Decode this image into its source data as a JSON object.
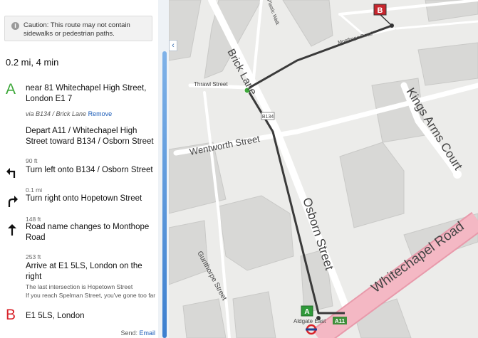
{
  "directions": {
    "caution": "Caution: This route may not contain sidewalks or pedestrian paths.",
    "caution_icon": "info-icon",
    "summary": "0.2 mi, 4 min",
    "start": {
      "letter": "A",
      "address": "near 81 Whitechapel High Street, London E1 7"
    },
    "via": {
      "text": "via B134 / Brick Lane",
      "remove": "Remove"
    },
    "steps": [
      {
        "instruction": "Depart A11 / Whitechapel High Street toward B134 / Osborn Street"
      },
      {
        "distance": "90 ft",
        "instruction": "Turn left onto B134 / Osborn Street",
        "icon": "turn-left-icon"
      },
      {
        "distance": "0.1 mi",
        "instruction": "Turn right onto Hopetown Street",
        "icon": "turn-right-icon"
      },
      {
        "distance": "148 ft",
        "instruction": "Road name changes to Monthope Road",
        "icon": "straight-arrow-icon"
      },
      {
        "distance": "253 ft",
        "instruction": "Arrive at E1 5LS, London on the right",
        "notes": [
          "The last intersection is Hopetown Street",
          "If you reach Spelman Street, you've gone too far"
        ]
      }
    ],
    "end": {
      "letter": "B",
      "address": "E1 5LS, London"
    },
    "send": {
      "label": "Send:",
      "link": "Email"
    }
  },
  "map": {
    "streets": {
      "brick_lane": "Brick Lane",
      "osborn": "Osborn Street",
      "whitechapel": "Whitechapel Road",
      "wentworth": "Wentworth Street",
      "kings_arms": "Kings Arms Court",
      "thrawl": "Thrawl Street",
      "monthope": "Monthope Road",
      "gunthorpe": "Gunthorpe Street",
      "plastic_walk": "Plastic Walk",
      "b134": "B134",
      "a11": "A11",
      "station": "Aldgate East"
    },
    "markers": {
      "a": "A",
      "b": "B"
    },
    "colors": {
      "route": "#3a3a3a",
      "start": "#2f9a3a",
      "end": "#c8262d",
      "major_road": "#f2a7b5"
    }
  }
}
